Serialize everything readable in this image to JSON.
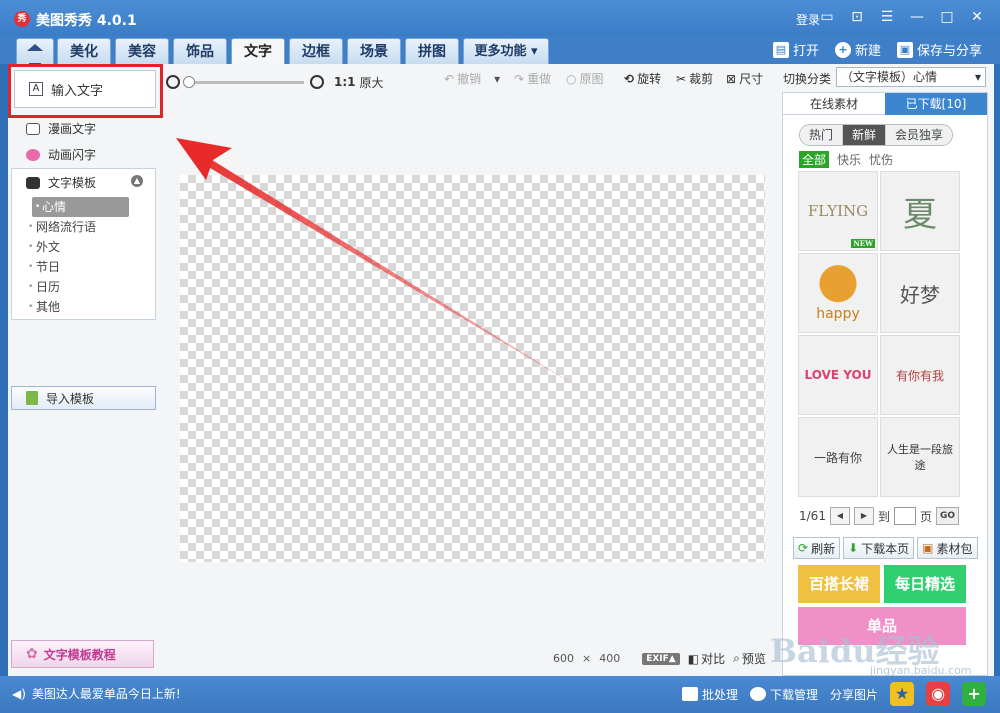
{
  "app": {
    "title": "美图秀秀 4.0.1",
    "logo_text": "秀",
    "login": "登录"
  },
  "tabs": [
    {
      "label": "美化"
    },
    {
      "label": "美容"
    },
    {
      "label": "饰品"
    },
    {
      "label": "文字",
      "active": true
    },
    {
      "label": "边框"
    },
    {
      "label": "场景"
    },
    {
      "label": "拼图"
    },
    {
      "label": "更多功能 ▾"
    }
  ],
  "top_actions": {
    "open": "打开",
    "new": "新建",
    "save": "保存与分享"
  },
  "left": {
    "input_text": "输入文字",
    "comic_text": "漫画文字",
    "animated_text": "动画闪字",
    "template_header": "文字模板",
    "template_items": [
      "心情",
      "网络流行语",
      "外文",
      "节日",
      "日历",
      "其他"
    ],
    "import_template": "导入模板",
    "tutorial": "文字模板教程"
  },
  "toolbar": {
    "ratio": "1:1",
    "original_size": "原大",
    "undo": "撤销",
    "redo": "重做",
    "original_image": "原图",
    "rotate": "旋转",
    "crop": "裁剪",
    "size": "尺寸"
  },
  "canvas_info": {
    "width": "600",
    "times": "×",
    "height": "400",
    "exif": "EXIF▲",
    "compare": "对比",
    "preview": "预览"
  },
  "right": {
    "switch_label": "切换分类",
    "switch_value": "（文字模板）心情",
    "tab_online": "在线素材",
    "tab_downloaded": "已下载[10]",
    "filter_pills": [
      "热门",
      "新鲜",
      "会员独享"
    ],
    "categories": [
      "全部",
      "快乐",
      "忧伤"
    ],
    "stickers": [
      "FLYING",
      "夏",
      "happy",
      "好梦",
      "LOVE YOU",
      "有你有我",
      "一路有你",
      "人生是一段旅途"
    ],
    "new_badge": "NEW",
    "page": "1/61",
    "goto_prefix": "到",
    "goto_suffix": "页",
    "go": "GO",
    "refresh": "刷新",
    "download_page": "下载本页",
    "material_pack": "素材包",
    "banner1": "百搭长裙",
    "banner2": "每日精选",
    "banner3": "单品"
  },
  "status": {
    "news": "美图达人最爱单品今日上新!",
    "batch": "批处理",
    "download_manager": "下载管理",
    "share_image": "分享图片"
  },
  "watermark": {
    "brand": "Baidu经验",
    "url": "jingyan.baidu.com"
  },
  "colors": {
    "accent": "#3a7cc6",
    "highlight": "#e0242c",
    "green": "#2aa52a"
  }
}
